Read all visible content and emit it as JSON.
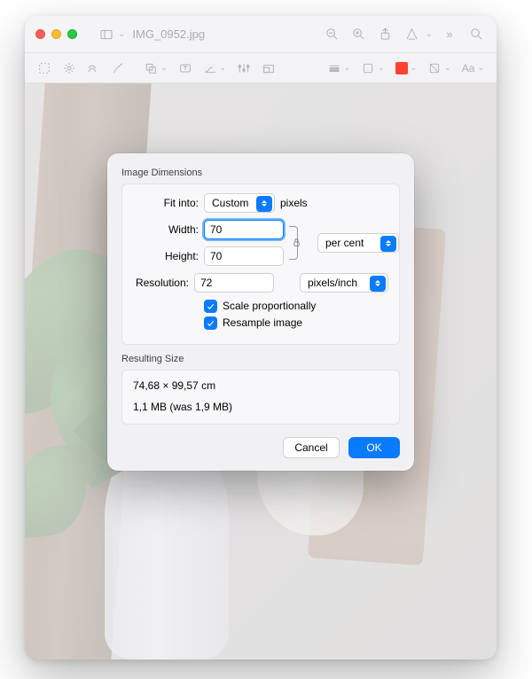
{
  "window": {
    "filename": "IMG_0952.jpg"
  },
  "modal": {
    "section_label": "Image Dimensions",
    "fit_into_label": "Fit into:",
    "fit_into_value": "Custom",
    "fit_into_unit": "pixels",
    "width_label": "Width:",
    "width_value": "70",
    "height_label": "Height:",
    "height_value": "70",
    "wh_unit": "per cent",
    "resolution_label": "Resolution:",
    "resolution_value": "72",
    "resolution_unit": "pixels/inch",
    "scale_label": "Scale proportionally",
    "resample_label": "Resample image",
    "resulting_label": "Resulting Size",
    "resulting_dims": "74,68 × 99,57 cm",
    "resulting_size": "1,1 MB (was 1,9 MB)",
    "cancel": "Cancel",
    "ok": "OK"
  }
}
